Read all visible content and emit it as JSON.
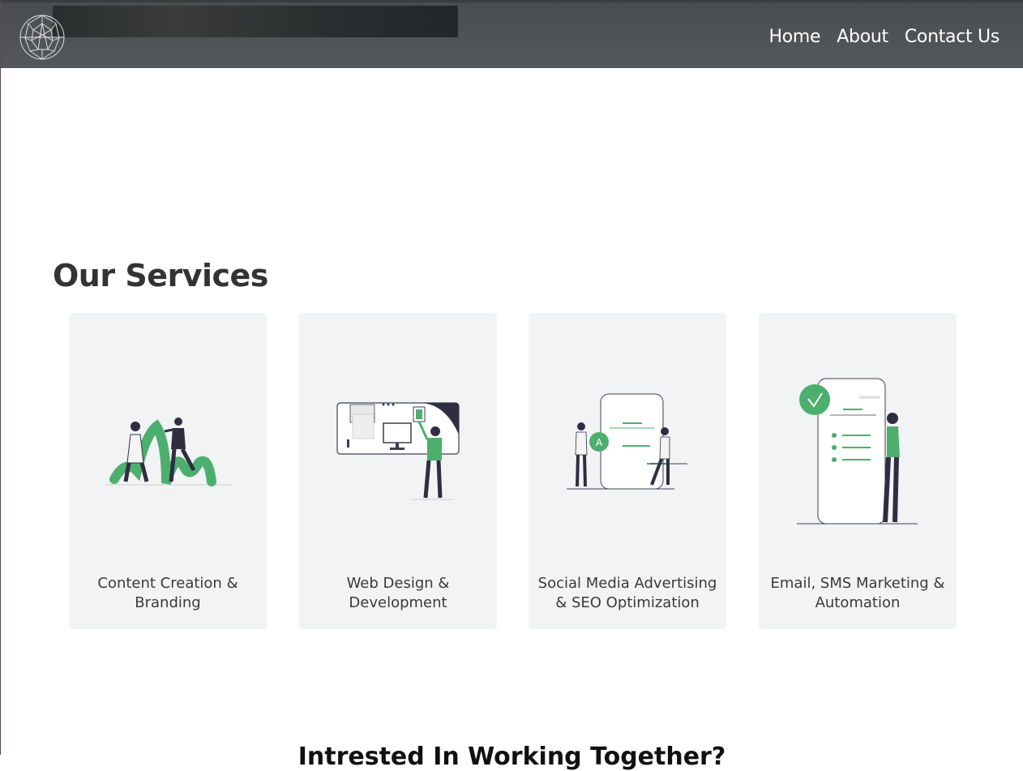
{
  "header": {
    "logo_icon": "geodesic-sphere-icon",
    "nav": [
      "Home",
      "About",
      "Contact Us"
    ]
  },
  "services": {
    "title": "Our Services",
    "cards": [
      {
        "label": "Content Creation & Branding",
        "icon": "creative-people-illustration"
      },
      {
        "label": "Web Design & Development",
        "icon": "web-design-illustration"
      },
      {
        "label": "Social Media Advertising & SEO Optimization",
        "icon": "social-media-phone-illustration"
      },
      {
        "label": "Email, SMS Marketing & Automation",
        "icon": "checklist-phone-illustration"
      }
    ]
  },
  "cta": {
    "title": "Intrested In Working Together?"
  },
  "colors": {
    "accent": "#4caf6e",
    "header_bg": "#4f5255",
    "card_bg": "#f2f3f5",
    "text": "#333333"
  }
}
